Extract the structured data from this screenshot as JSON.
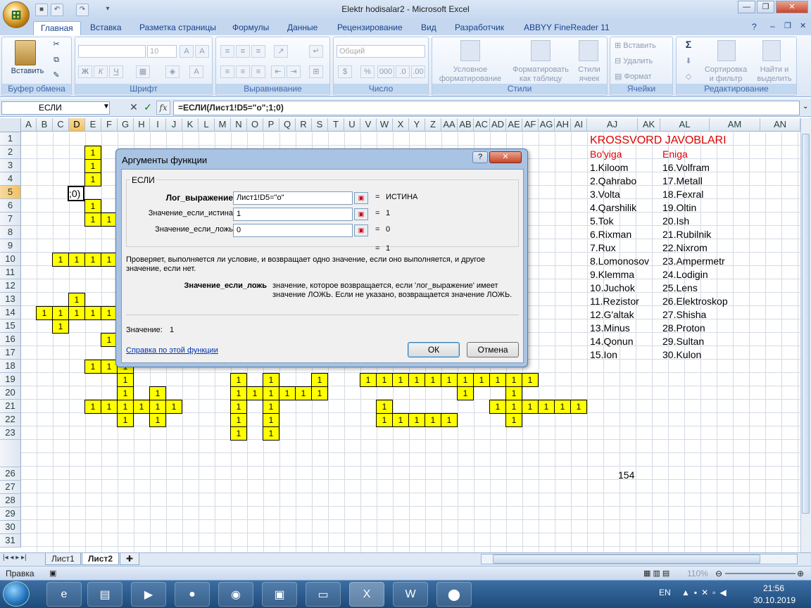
{
  "window": {
    "title": "Elektr hodisalar2 - Microsoft Excel"
  },
  "qat": {
    "save_icon": "floppy-icon",
    "undo_icon": "undo-icon",
    "redo_icon": "redo-icon",
    "more_icon": "chevron-down-icon"
  },
  "window_controls": {
    "minimize": "—",
    "restore": "❐",
    "close": "✕"
  },
  "ribbon_tabs": [
    "Главная",
    "Вставка",
    "Разметка страницы",
    "Формулы",
    "Данные",
    "Рецензирование",
    "Вид",
    "Разработчик",
    "ABBYY FineReader 11"
  ],
  "ribbon": {
    "paste_label": "Вставить",
    "clipboard_label": "Буфер обмена",
    "font_label": "Шрифт",
    "font_size": "10",
    "bold": "Ж",
    "italic": "К",
    "underline": "Ч",
    "alignment_label": "Выравнивание",
    "number_label": "Число",
    "number_format": "Общий",
    "percent": "%",
    "thousands": "000",
    "cond_format": "Условное\nформатирование",
    "format_table": "Форматировать\nкак таблицу",
    "cell_styles": "Стили\nячеек",
    "styles_label": "Стили",
    "insert": "Вставить",
    "delete": "Удалить",
    "format": "Формат",
    "cells_label": "Ячейки",
    "sort_filter": "Сортировка\nи фильтр",
    "find_select": "Найти и\nвыделить",
    "editing_label": "Редактирование"
  },
  "formula_bar": {
    "name_box": "ЕСЛИ",
    "formula": "=ЕСЛИ(Лист1!D5=\"о\";1;0)",
    "fx": "fx"
  },
  "columns": [
    "A",
    "B",
    "C",
    "D",
    "E",
    "F",
    "G",
    "H",
    "I",
    "J",
    "K",
    "L",
    "M",
    "N",
    "O",
    "P",
    "Q",
    "R",
    "S",
    "T",
    "U",
    "V",
    "W",
    "X",
    "Y",
    "Z",
    "AA",
    "AB",
    "AC",
    "AD",
    "AE",
    "AF",
    "AG",
    "AH",
    "AI",
    "AJ",
    "AK",
    "AL",
    "AM",
    "AN"
  ],
  "rows": [
    "1",
    "2",
    "3",
    "4",
    "5",
    "6",
    "7",
    "8",
    "9",
    "10",
    "11",
    "12",
    "13",
    "14",
    "15",
    "16",
    "17",
    "18",
    "19",
    "20",
    "21",
    "22",
    "23",
    "26",
    "27",
    "28",
    "29",
    "30",
    "31"
  ],
  "active_cell_value": ";0)",
  "cell_one": "1",
  "answers": {
    "title": "KROSSVORD JAVOBLARI",
    "col1_header": "Bo'yiga",
    "col2_header": "Eniga",
    "col1": [
      "1.Kiloom",
      "2.Qahrabo",
      "3.Volta",
      "4.Qarshilik",
      "5.Tok",
      "6.Rixman",
      "7.Rux",
      "8.Lomonosov",
      "9.Klemma",
      "10.Juchok",
      "11.Rezistor",
      "12.G'altak",
      "13.Minus",
      "14.Qonun",
      "15.Ion"
    ],
    "col2": [
      "16.Volfram",
      "17.Metall",
      "18.Fexral",
      "19.Oltin",
      "20.Ish",
      "21.Rubilnik",
      "22.Nixrom",
      "23.Ampermetr",
      "24.Lodigin",
      "25.Lens",
      "26.Elektroskop",
      "27.Shisha",
      "28.Proton",
      "29.Sultan",
      "30.Kulon"
    ],
    "total": "154"
  },
  "dialog": {
    "title": "Аргументы функции",
    "help_glyph": "?",
    "close_glyph": "✕",
    "function_name": "ЕСЛИ",
    "args": [
      {
        "label": "Лог_выражение",
        "value": "Лист1!D5=\"о\"",
        "result": "ИСТИНА",
        "bold": true
      },
      {
        "label": "Значение_если_истина",
        "value": "1",
        "result": "1"
      },
      {
        "label": "Значение_если_ложь",
        "value": "0",
        "result": "0"
      }
    ],
    "eq": "=",
    "overall_result": "1",
    "description": "Проверяет, выполняется ли условие, и возвращает одно значение, если оно выполняется, и другое значение, если нет.",
    "arg_help_name": "Значение_если_ложь",
    "arg_help_text": "значение, которое возвращается, если 'лог_выражение' имеет значение ЛОЖЬ. Если не указано, возвращается значение ЛОЖЬ.",
    "value_label": "Значение:",
    "value": "1",
    "help_link": "Справка по этой функции",
    "ok": "ОК",
    "cancel": "Отмена"
  },
  "sheets": [
    "Лист1",
    "Лист2"
  ],
  "status": {
    "mode": "Правка",
    "zoom": "110%"
  },
  "taskbar": {
    "lang": "EN",
    "time": "21:56",
    "date": "30.10.2019"
  }
}
